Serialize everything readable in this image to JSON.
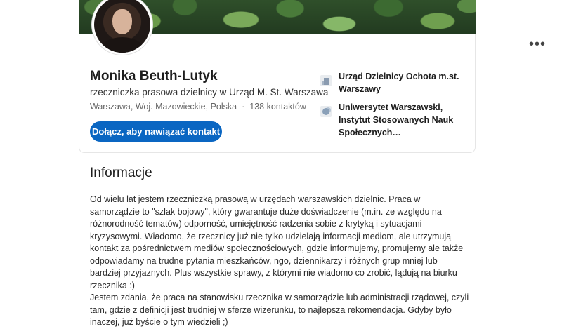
{
  "profile": {
    "name": "Monika Beuth-Lutyk",
    "headline": "rzeczniczka prasowa dzielnicy w Urząd M. St. Warszawa",
    "location": "Warszawa, Woj. Mazowieckie, Polska",
    "separator": "·",
    "connections": "138 kontaktów",
    "connect_label": "Dołącz, aby nawiązać kontakt",
    "more_label": "•••"
  },
  "organizations": [
    {
      "name": "Urząd Dzielnicy Ochota m.st. Warszawy",
      "icon": "building-icon"
    },
    {
      "name": "Uniwersytet Warszawski, Instytut Stosowanych Nauk Społecznych…",
      "icon": "school-icon"
    }
  ],
  "about": {
    "title": "Informacje",
    "text": "Od wielu lat jestem rzeczniczką prasową w urzędach warszawskich dzielnic. Praca w samorządzie to \"szlak bojowy\", który gwarantuje duże doświadczenie (m.in. ze względu na różnorodność tematów) odporność, umiejętność radzenia sobie z krytyką i sytuacjami kryzysowymi. Wiadomo, że rzecznicy już nie tylko udzielają informacji mediom, ale utrzymują kontakt za pośrednictwem mediów społecznościowych, gdzie informujemy, promujemy ale także odpowiadamy na trudne pytania mieszkańców, ngo, dziennikarzy i różnych grup mniej lub bardziej przyjaznych. Plus wszystkie sprawy, z którymi nie wiadomo co zrobić, lądują na biurku rzecznika :)\nJestem zdania, że praca na stanowisku rzecznika w samorządzie lub administracji rządowej, czyli tam, gdzie z definicji jest trudniej w sferze wizerunku, to najlepsza rekomendacja. Gdyby było inaczej, już byście o tym wiedzieli ;)"
  },
  "colors": {
    "accent": "#0a66c2",
    "text": "#1d1d1d",
    "muted": "#666666"
  }
}
